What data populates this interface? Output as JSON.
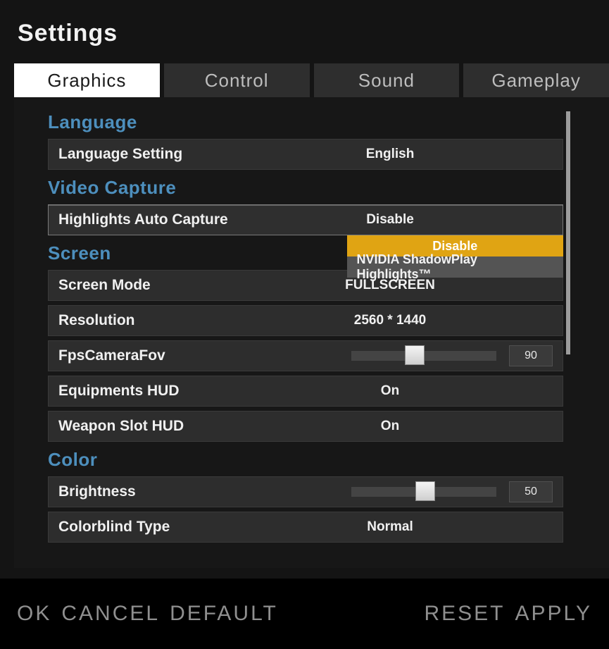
{
  "title": "Settings",
  "tabs": {
    "graphics": "Graphics",
    "control": "Control",
    "sound": "Sound",
    "gameplay": "Gameplay",
    "active": "graphics"
  },
  "sections": {
    "language": {
      "title": "Language",
      "language_setting": {
        "label": "Language Setting",
        "value": "English"
      }
    },
    "video_capture": {
      "title": "Video Capture",
      "highlights": {
        "label": "Highlights Auto Capture",
        "value": "Disable",
        "options": [
          "Disable",
          "NVIDIA ShadowPlay Highlights™"
        ],
        "selected_index": 0,
        "open": true
      }
    },
    "screen": {
      "title": "Screen",
      "screen_mode": {
        "label": "Screen Mode",
        "value": "FULLSCREEN"
      },
      "resolution": {
        "label": "Resolution",
        "value": "2560 * 1440"
      },
      "fov": {
        "label": "FpsCameraFov",
        "value": 90,
        "min": 0,
        "max": 180,
        "thumb_pct": 37
      },
      "equipments_hud": {
        "label": "Equipments HUD",
        "value": "On"
      },
      "weapon_slot_hud": {
        "label": "Weapon Slot HUD",
        "value": "On"
      }
    },
    "color": {
      "title": "Color",
      "brightness": {
        "label": "Brightness",
        "value": 50,
        "min": 0,
        "max": 100,
        "thumb_pct": 44
      },
      "colorblind": {
        "label": "Colorblind Type",
        "value": "Normal"
      }
    }
  },
  "footer": {
    "ok": "OK",
    "cancel": "CANCEL",
    "default": "DEFAULT",
    "reset": "RESET",
    "apply": "APPLY"
  }
}
